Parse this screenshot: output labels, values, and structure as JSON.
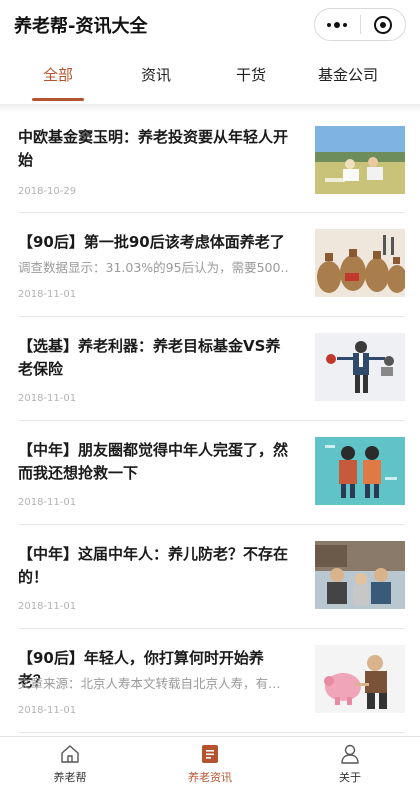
{
  "app": {
    "title": "养老帮-资讯大全"
  },
  "tabs": [
    {
      "label": "全部",
      "active": true
    },
    {
      "label": "资讯",
      "active": false
    },
    {
      "label": "干货",
      "active": false
    },
    {
      "label": "基金公司",
      "active": false
    }
  ],
  "articles": [
    {
      "title": "中欧基金窦玉明：养老投资要从年轻人开始",
      "summary": "",
      "date": "2018-10-29",
      "thumb": "people-on-lawn-photo"
    },
    {
      "title": "【90后】第一批90后该考虑体面养老了",
      "summary": "调查数据显示：31.03%的95后认为，需要500…",
      "date": "2018-11-01",
      "thumb": "money-bags-photo"
    },
    {
      "title": "【选基】养老利器：养老目标基金VS养老保险",
      "summary": "",
      "date": "2018-11-01",
      "thumb": "businessman-illustration"
    },
    {
      "title": "【中年】朋友圈都觉得中年人完蛋了，然而我还想抢救一下",
      "summary": "",
      "date": "2018-11-01",
      "thumb": "couple-illustration"
    },
    {
      "title": "【中年】这届中年人：养儿防老？不存在的！",
      "summary": "",
      "date": "2018-11-01",
      "thumb": "family-photo"
    },
    {
      "title": "【90后】年轻人，你打算何时开始养老？",
      "summary": "文章来源：北京人寿本文转载自北京人寿，有…",
      "date": "2018-11-01",
      "thumb": "elderly-piggy-bank-photo"
    }
  ],
  "bottom_nav": [
    {
      "label": "养老帮",
      "icon": "home-icon",
      "active": false
    },
    {
      "label": "养老资讯",
      "icon": "news-icon",
      "active": true
    },
    {
      "label": "关于",
      "icon": "user-icon",
      "active": false
    }
  ],
  "colors": {
    "accent": "#b5532f",
    "text": "#1a1a1a",
    "muted": "#9a9a9a"
  }
}
